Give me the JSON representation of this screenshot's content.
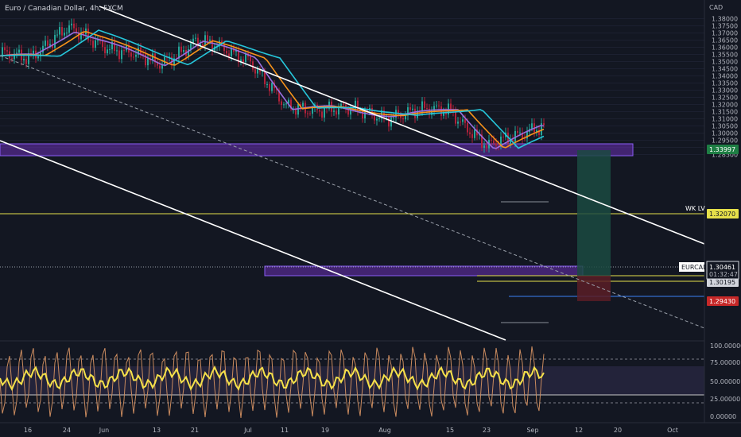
{
  "header": {
    "title": "Euro / Canadian Dollar, 4h, FXCM",
    "currency": "CAD"
  },
  "price_axis": {
    "ticks": [
      "1.38000",
      "1.37500",
      "1.37000",
      "1.36500",
      "1.36000",
      "1.35500",
      "1.35000",
      "1.34500",
      "1.34000",
      "1.33500",
      "1.33000",
      "1.32500",
      "1.32000",
      "1.31500",
      "1.31000",
      "1.30500",
      "1.30000",
      "1.29500",
      "1.29000",
      "1.28500"
    ]
  },
  "osc_axis": {
    "ticks": [
      "100.00000",
      "75.00000",
      "50.00000",
      "25.00000",
      "0.00000"
    ]
  },
  "time_axis": {
    "ticks": [
      "16",
      "24",
      "Jun",
      "13",
      "21",
      "Jul",
      "11",
      "19",
      "Aug",
      "15",
      "23",
      "Sep",
      "12",
      "20",
      "Oct"
    ]
  },
  "price_labels": {
    "level_top": "1.33997",
    "wk_lv_text": "WK LV",
    "wk_lv": "1.32070",
    "symbol": "EURCAD",
    "last_price": "1.30461",
    "countdown": "01:32:47",
    "level_mid": "1.30195",
    "stop": "1.29430"
  },
  "colors": {
    "background": "#131722",
    "bull": "#26a69a",
    "bear": "#b0223a",
    "ema_cyan": "#26c6da",
    "ema_orange": "#f7931a",
    "ema_violet": "#9c6fe0",
    "zone": "#6a2fb3",
    "level_yellow": "#e6e04a",
    "rsi": "#f5e14a",
    "stoch": "#c98a5e"
  },
  "chart_data": {
    "type": "candlestick",
    "title": "Euro / Canadian Dollar, 4h, FXCM",
    "y_range": [
      1.285,
      1.382
    ],
    "key_levels": [
      {
        "name": "upper zone",
        "from": 1.3385,
        "to": 1.3402
      },
      {
        "name": "WK LV",
        "value": 1.3207
      },
      {
        "name": "lower zone",
        "from": 1.3036,
        "to": 1.305
      },
      {
        "name": "level",
        "value": 1.30195
      },
      {
        "name": "stop",
        "value": 1.2943
      }
    ],
    "approx_close_path": [
      {
        "x": "May 16",
        "y": 1.354
      },
      {
        "x": "May 24",
        "y": 1.372
      },
      {
        "x": "Jun",
        "y": 1.362
      },
      {
        "x": "Jun 13",
        "y": 1.348
      },
      {
        "x": "Jun 21",
        "y": 1.364
      },
      {
        "x": "Jul",
        "y": 1.353
      },
      {
        "x": "Jul 11",
        "y": 1.317
      },
      {
        "x": "Jul 19",
        "y": 1.318
      },
      {
        "x": "Aug",
        "y": 1.312
      },
      {
        "x": "Aug 15",
        "y": 1.317
      },
      {
        "x": "Aug 23",
        "y": 1.289
      },
      {
        "x": "Sep",
        "y": 1.3046
      }
    ],
    "oscillator_range": [
      0,
      100
    ]
  }
}
